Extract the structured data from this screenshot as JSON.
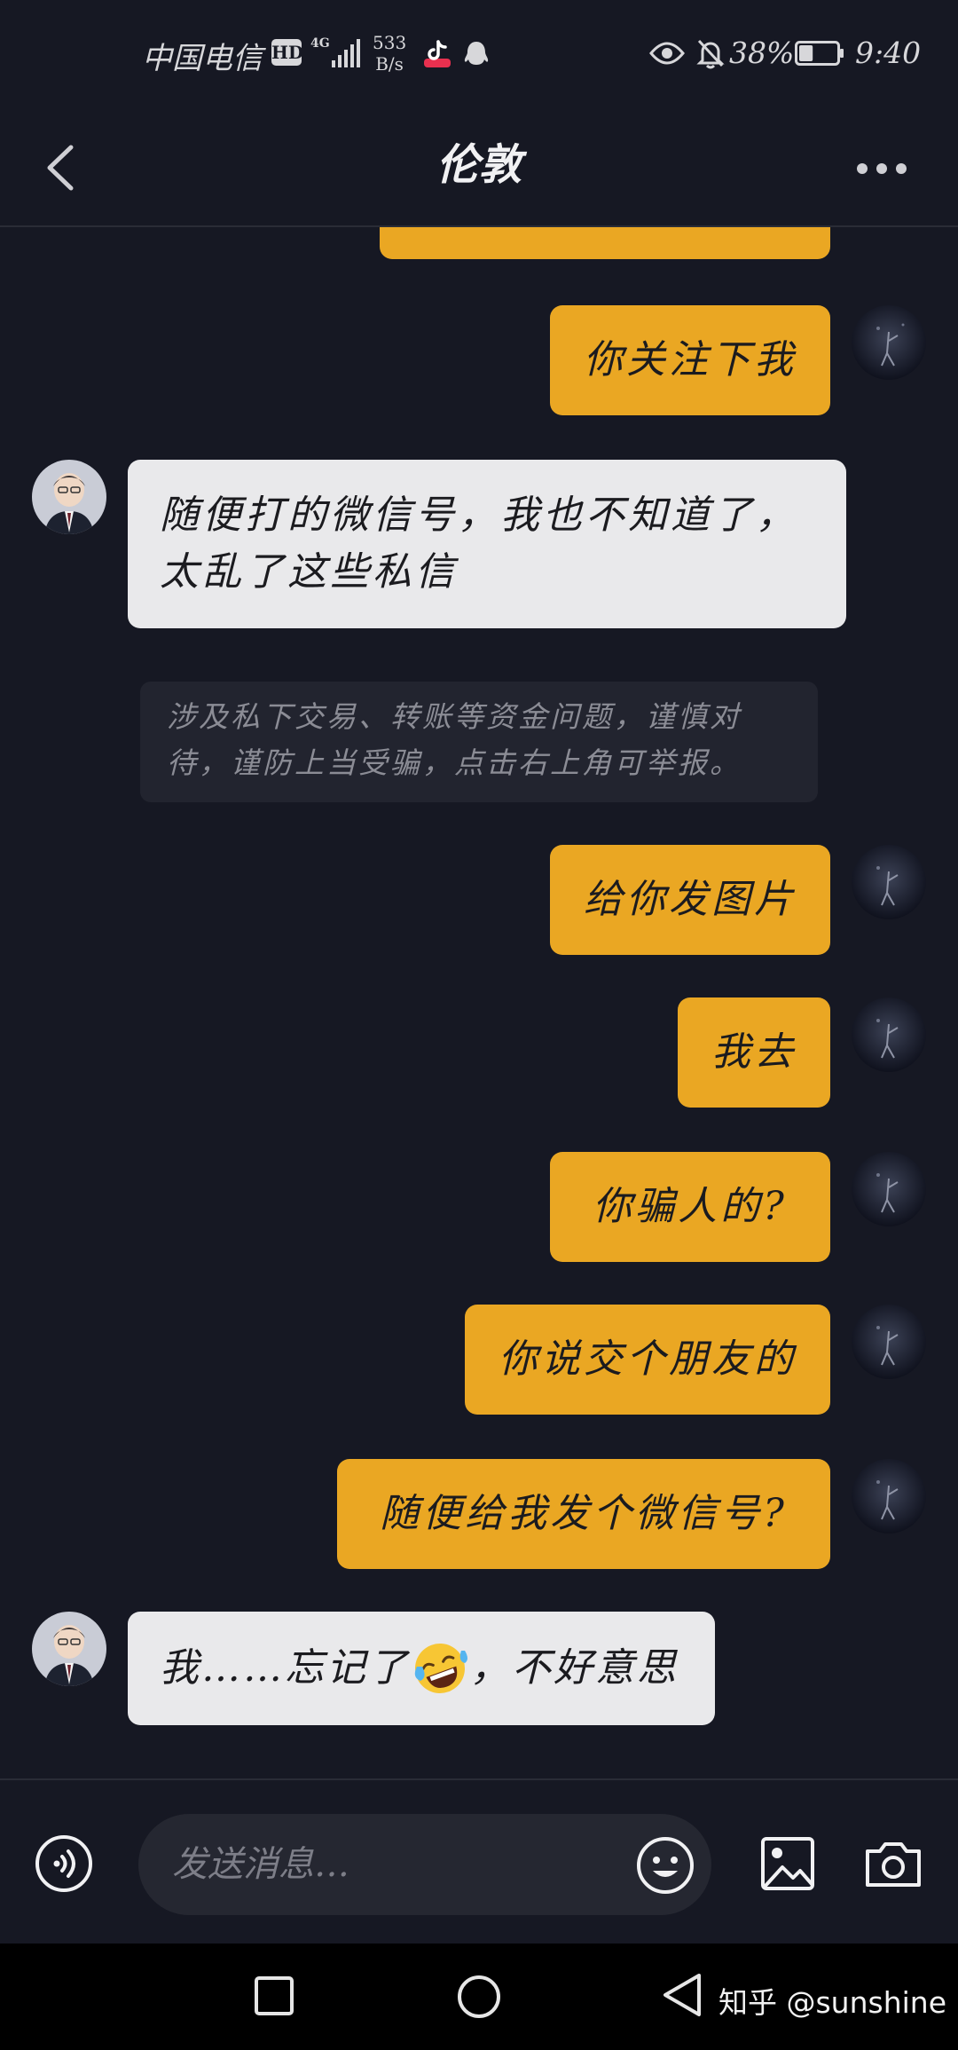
{
  "status_bar": {
    "carrier": "中国电信",
    "hd": "HD",
    "network": "4G",
    "speed_value": "533",
    "speed_unit": "B/s",
    "battery_percent": "38%",
    "time": "9:40",
    "battery_level": 0.38,
    "icons": [
      "tiktok-icon",
      "qq-icon",
      "eye-icon",
      "bell-off-icon",
      "battery-icon"
    ]
  },
  "header": {
    "title": "伦敦",
    "icons": [
      "back-icon",
      "more-icon"
    ]
  },
  "messages": [
    {
      "side": "out",
      "text": "你关注下我"
    },
    {
      "side": "in",
      "text": "随便打的微信号，我也不知道了，太乱了这些私信"
    },
    {
      "side": "system",
      "text": "涉及私下交易、转账等资金问题，谨慎对待，谨防上当受骗，点击右上角可举报。"
    },
    {
      "side": "out",
      "text": "给你发图片"
    },
    {
      "side": "out",
      "text": "我去"
    },
    {
      "side": "out",
      "text": "你骗人的?"
    },
    {
      "side": "out",
      "text": "你说交个朋友的"
    },
    {
      "side": "out",
      "text": "随便给我发个微信号?"
    },
    {
      "side": "in",
      "text_before": "我……忘记了",
      "emoji": "rofl-emoji",
      "text_after": "，不好意思"
    }
  ],
  "input": {
    "placeholder": "发送消息…",
    "icons": [
      "voice-icon",
      "emoji-icon",
      "image-icon",
      "camera-icon"
    ]
  },
  "nav_bar": {
    "icons": [
      "recent-apps-icon",
      "home-icon",
      "back-triangle-icon"
    ],
    "watermark": "知乎 @sunshine"
  },
  "colors": {
    "background": "#161823",
    "outgoing_bubble": "#eaa723",
    "incoming_bubble": "#e9e9eb",
    "notice_bg": "#22242f"
  }
}
